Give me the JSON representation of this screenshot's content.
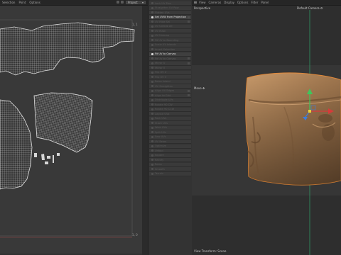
{
  "uv_editor": {
    "menu": [
      "Selection",
      "Point",
      "Options"
    ],
    "dropdown_value": "Project",
    "coords": {
      "top_right": "1, 1",
      "bottom_right": "1, 0"
    }
  },
  "tool_panel": {
    "items": [
      {
        "label": "Lock UV Pins",
        "state": "plain"
      },
      {
        "label": "Straighten UV Row",
        "state": "plain"
      },
      {
        "label": "Flatten UVs",
        "state": "plain"
      },
      {
        "label": "Set UVW from Projection",
        "state": "active"
      },
      {
        "label": "UV Hide Sel",
        "state": "plain"
      },
      {
        "label": "UV Unhide All",
        "state": "plain"
      },
      {
        "label": "UV Mask",
        "state": "plain"
      },
      {
        "label": "UV Unwrap",
        "state": "plain"
      },
      {
        "label": "Fit UV to Bounding",
        "state": "plain"
      },
      {
        "label": "Scale UV Islands",
        "state": "plain"
      },
      {
        "label": "Invert Selection",
        "state": "plain"
      },
      {
        "label": "Fit UV to Canvas",
        "state": "active"
      },
      {
        "label": "Fit UV to Canvas",
        "state": "plain"
      },
      {
        "label": "Mirror U",
        "state": "plain"
      },
      {
        "label": "Mirror V",
        "state": "plain"
      },
      {
        "label": "Flip UV U",
        "state": "plain"
      },
      {
        "label": "Flip UV V",
        "state": "plain"
      },
      {
        "label": "Relax Island",
        "state": "plain"
      },
      {
        "label": "UV Straighten",
        "state": "plain"
      },
      {
        "label": "Align UV Edges",
        "state": "plain"
      },
      {
        "label": "Align to Grid",
        "state": "plain"
      },
      {
        "label": "Distribute UVs",
        "state": "plain"
      },
      {
        "label": "Rotate 90 CW",
        "state": "plain"
      },
      {
        "label": "Rotate 90 CCW",
        "state": "plain"
      },
      {
        "label": "Layout UVs",
        "state": "plain"
      },
      {
        "label": "Pack UVs",
        "state": "plain"
      },
      {
        "label": "Stack UVs",
        "state": "plain"
      },
      {
        "label": "Weld UVs",
        "state": "plain"
      },
      {
        "label": "Split UVs",
        "state": "plain"
      },
      {
        "label": "Sew UVs",
        "state": "plain"
      },
      {
        "label": "UV Seam",
        "state": "plain"
      },
      {
        "label": "Optimize",
        "state": "plain"
      },
      {
        "label": "Unfold",
        "state": "plain"
      },
      {
        "label": "Square",
        "state": "plain"
      },
      {
        "label": "Rectify",
        "state": "plain"
      },
      {
        "label": "Relax",
        "state": "plain"
      },
      {
        "label": "Smooth",
        "state": "plain"
      },
      {
        "label": "Terrain",
        "state": "plain"
      }
    ]
  },
  "viewport": {
    "menu": [
      "View",
      "Cameras",
      "Display",
      "Options",
      "Filter",
      "Panel"
    ],
    "perspective_label": "Perspective",
    "camera_label": "Default Camera",
    "tool_label": "Move",
    "bottom_label": "View Transform: Scene"
  },
  "colors": {
    "uv_lines": "#d6d6d6",
    "model": "#a87c52",
    "model_outline": "#e0892e",
    "axis_x": "#d63b3b",
    "axis_y": "#3fc65b",
    "axis_z": "#3b7ee0"
  }
}
